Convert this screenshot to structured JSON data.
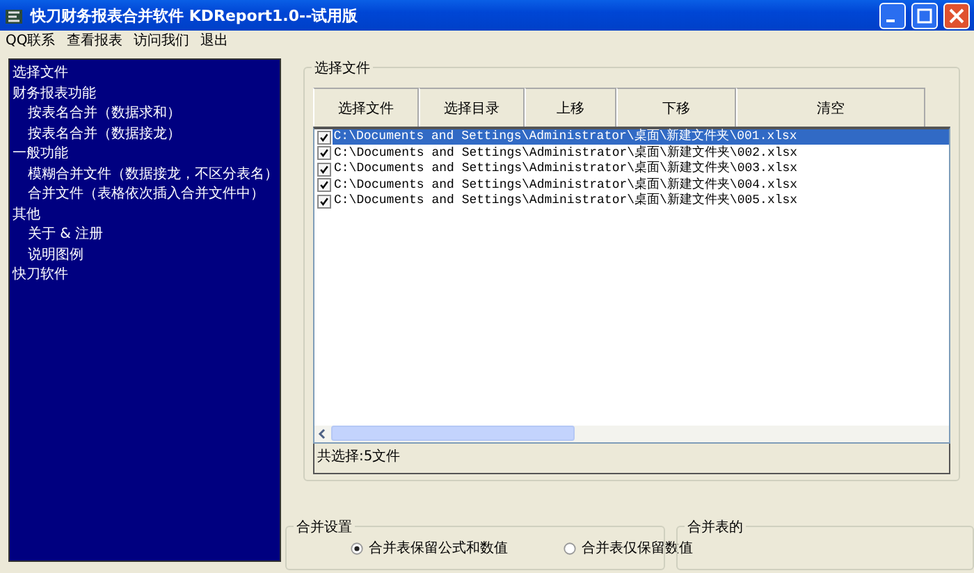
{
  "window": {
    "title": "快刀财务报表合并软件 KDReport1.0--试用版"
  },
  "menu": [
    "QQ联系",
    "查看报表",
    "访问我们",
    "退出"
  ],
  "sidebar": {
    "items": [
      {
        "label": "选择文件"
      },
      {
        "label": "财务报表功能",
        "children": [
          {
            "label": "按表名合并（数据求和）"
          },
          {
            "label": "按表名合并（数据接龙）"
          }
        ]
      },
      {
        "label": "一般功能",
        "children": [
          {
            "label": "模糊合并文件（数据接龙，不区分表名）"
          },
          {
            "label": "合并文件（表格依次插入合并文件中）"
          }
        ]
      },
      {
        "label": "其他",
        "children": [
          {
            "label": "关于 & 注册"
          },
          {
            "label": "说明图例"
          }
        ]
      },
      {
        "label": "快刀软件"
      }
    ]
  },
  "file_group": {
    "title": "选择文件",
    "buttons": [
      "选择文件",
      "选择目录",
      "上移",
      "下移",
      "清空"
    ],
    "files": [
      {
        "path": "C:\\Documents and Settings\\Administrator\\桌面\\新建文件夹\\001.xlsx",
        "checked": true,
        "selected": true
      },
      {
        "path": "C:\\Documents and Settings\\Administrator\\桌面\\新建文件夹\\002.xlsx",
        "checked": true,
        "selected": false
      },
      {
        "path": "C:\\Documents and Settings\\Administrator\\桌面\\新建文件夹\\003.xlsx",
        "checked": true,
        "selected": false
      },
      {
        "path": "C:\\Documents and Settings\\Administrator\\桌面\\新建文件夹\\004.xlsx",
        "checked": true,
        "selected": false
      },
      {
        "path": "C:\\Documents and Settings\\Administrator\\桌面\\新建文件夹\\005.xlsx",
        "checked": true,
        "selected": false
      }
    ],
    "status": "共选择:5文件"
  },
  "settings_group": {
    "title": "合并设置",
    "options": [
      {
        "label": "合并表保留公式和数值",
        "selected": true
      },
      {
        "label": "合并表仅保留数值",
        "selected": false
      }
    ]
  },
  "second_group": {
    "title": "合并表的"
  }
}
